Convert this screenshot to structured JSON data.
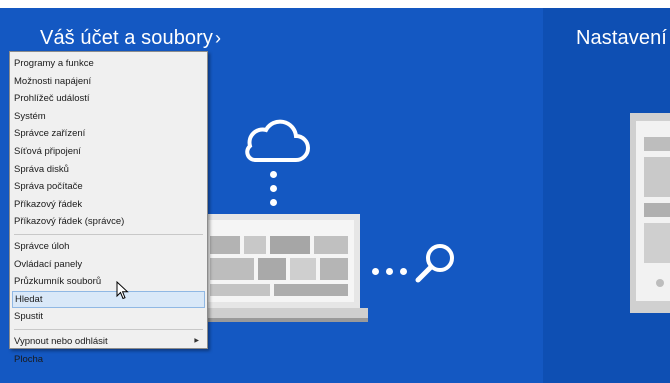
{
  "headings": {
    "account_files": "Váš účet a soubory",
    "account_chevron": "›",
    "settings": "Nastavení"
  },
  "menu": {
    "group1": [
      "Programy a funkce",
      "Možnosti napájení",
      "Prohlížeč událostí",
      "Systém",
      "Správce zařízení",
      "Síťová připojení",
      "Správa disků",
      "Správa počítače",
      "Příkazový řádek",
      "Příkazový řádek (správce)"
    ],
    "group2": [
      "Správce úloh",
      "Ovládací panely",
      "Průzkumník souborů",
      "Hledat",
      "Spustit"
    ],
    "group3": [
      "Vypnout nebo odhlásit",
      "Plocha"
    ],
    "submenu_arrow": "▶",
    "highlighted_item": "Hledat"
  },
  "colors": {
    "panel_left": "#1458c2",
    "panel_right": "#0e4fb3",
    "menu_bg": "#f0f0f0",
    "menu_highlight": "#d9e8f8"
  },
  "icons": [
    "cloud-icon",
    "laptop-icon",
    "magnifier-icon",
    "monitor-icon",
    "mouse-cursor-icon"
  ]
}
